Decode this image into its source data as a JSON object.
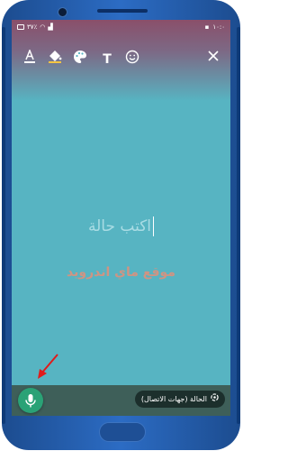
{
  "statusbar": {
    "time": "١٠:٠",
    "battery": "٣٧٪"
  },
  "toolbar": {
    "items": [
      "text-color-icon",
      "fill-color-icon",
      "palette-icon",
      "text-icon",
      "emoji-icon",
      "close-icon"
    ],
    "text_glyph": "T"
  },
  "editor": {
    "placeholder": "اكتب حالة"
  },
  "watermark": {
    "text": "موقع ماي اندرويد"
  },
  "bottom": {
    "status_audience": "الحالة (جهات الاتصال)"
  },
  "colors": {
    "accent": "#2aa276",
    "background": "#57b4c2",
    "bar": "#3e5f59",
    "arrow": "#e01b1b"
  }
}
